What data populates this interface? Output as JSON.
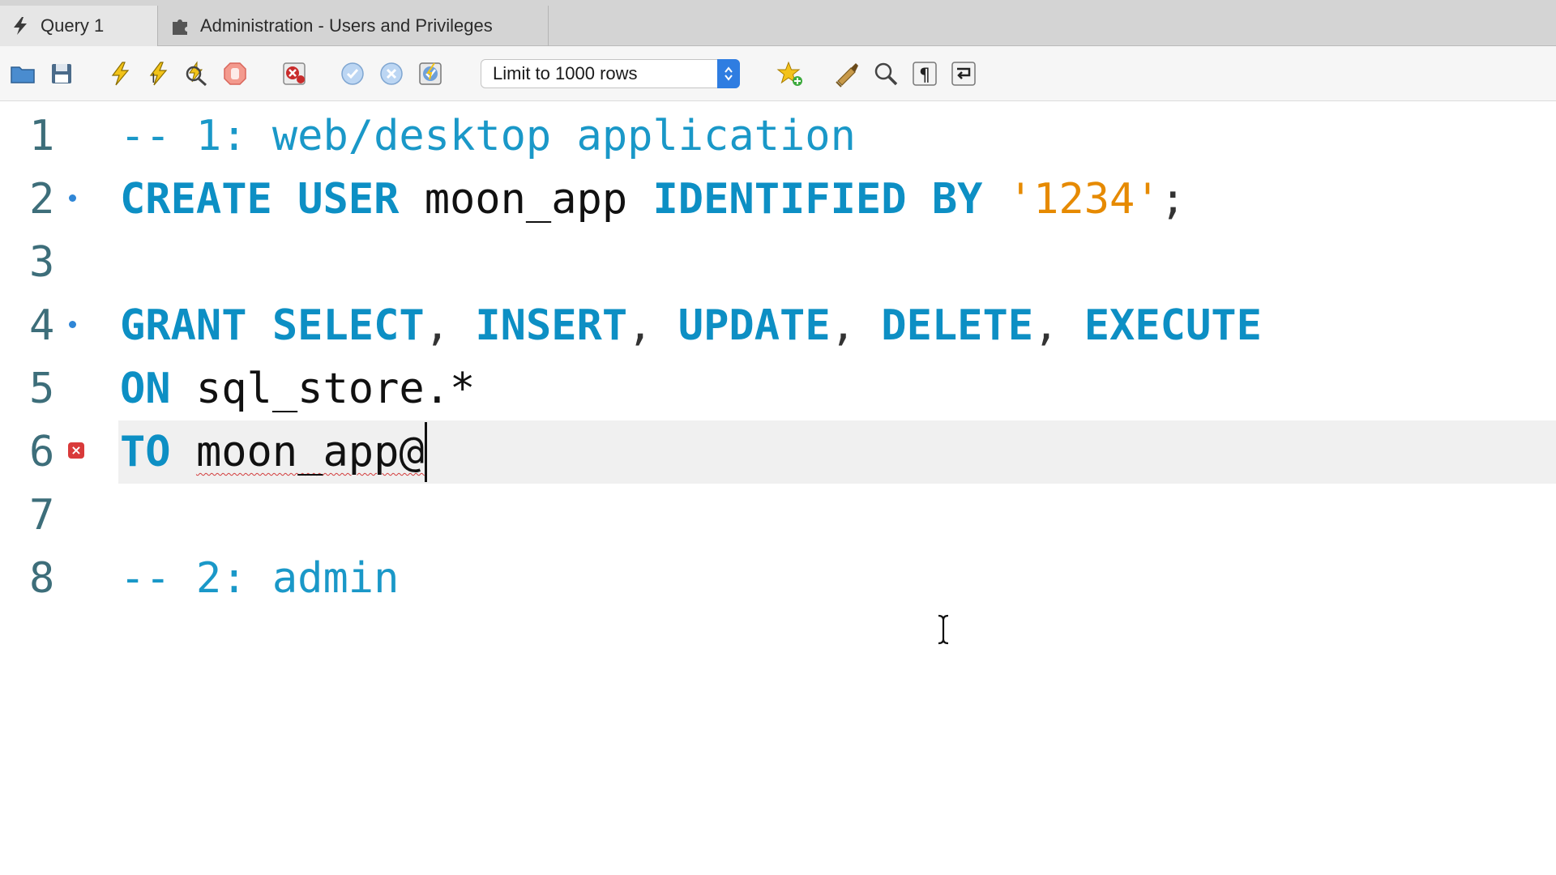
{
  "tabs": [
    {
      "label": "Query 1",
      "icon": "lightning-icon",
      "active": true
    },
    {
      "label": "Administration - Users and Privileges",
      "icon": "puzzle-icon",
      "active": false
    }
  ],
  "toolbar": {
    "buttons": [
      "open-folder-icon",
      "save-icon",
      "execute-icon",
      "execute-current-icon",
      "explain-icon",
      "stop-icon",
      "toggle-error-icon",
      "commit-icon",
      "rollback-icon",
      "autocommit-icon",
      "add-snippet-icon",
      "beautify-icon",
      "find-icon",
      "invisible-chars-icon",
      "wrap-lines-icon"
    ],
    "limit_label": "Limit to 1000 rows"
  },
  "editor": {
    "lines": [
      {
        "num": "1",
        "tokens": [
          {
            "t": "-- 1: web/desktop application",
            "c": "cm"
          }
        ]
      },
      {
        "num": "2",
        "marker": "dot",
        "tokens": [
          {
            "t": "CREATE",
            "c": "kw"
          },
          {
            "t": " ",
            "c": "id"
          },
          {
            "t": "USER",
            "c": "kw"
          },
          {
            "t": " moon_app ",
            "c": "id"
          },
          {
            "t": "IDENTIFIED",
            "c": "kw"
          },
          {
            "t": " ",
            "c": "id"
          },
          {
            "t": "BY",
            "c": "kw"
          },
          {
            "t": " ",
            "c": "id"
          },
          {
            "t": "'1234'",
            "c": "str"
          },
          {
            "t": ";",
            "c": "punct"
          }
        ]
      },
      {
        "num": "3",
        "tokens": []
      },
      {
        "num": "4",
        "marker": "dot",
        "tokens": [
          {
            "t": "GRANT",
            "c": "kw"
          },
          {
            "t": " ",
            "c": "id"
          },
          {
            "t": "SELECT",
            "c": "kw"
          },
          {
            "t": ", ",
            "c": "punct"
          },
          {
            "t": "INSERT",
            "c": "kw"
          },
          {
            "t": ", ",
            "c": "punct"
          },
          {
            "t": "UPDATE",
            "c": "kw"
          },
          {
            "t": ", ",
            "c": "punct"
          },
          {
            "t": "DELETE",
            "c": "kw"
          },
          {
            "t": ", ",
            "c": "punct"
          },
          {
            "t": "EXECUTE",
            "c": "kw"
          }
        ]
      },
      {
        "num": "5",
        "tokens": [
          {
            "t": "ON",
            "c": "kw"
          },
          {
            "t": " sql_store.*",
            "c": "id"
          }
        ]
      },
      {
        "num": "6",
        "marker": "error",
        "current": true,
        "tokens": [
          {
            "t": "TO",
            "c": "kw"
          },
          {
            "t": " ",
            "c": "id"
          },
          {
            "t": "moon_app@",
            "c": "id squiggle"
          }
        ]
      },
      {
        "num": "7",
        "tokens": []
      },
      {
        "num": "8",
        "tokens": [
          {
            "t": "-- 2: admin",
            "c": "cm"
          }
        ]
      }
    ]
  },
  "colors": {
    "keyword": "#0d8fc4",
    "comment": "#1a98c8",
    "string": "#e68a00",
    "line_number": "#3d6e7a",
    "current_line": "#f0f0f0",
    "error": "#d93a3a"
  }
}
